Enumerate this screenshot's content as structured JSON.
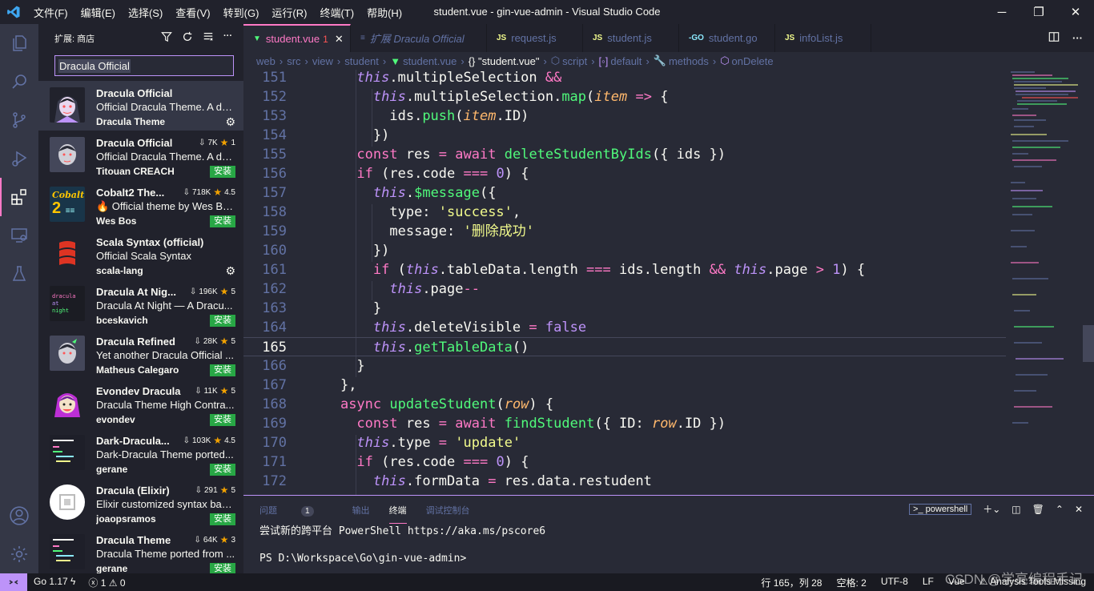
{
  "window": {
    "title": "student.vue - gin-vue-admin - Visual Studio Code",
    "menu": [
      "文件(F)",
      "编辑(E)",
      "选择(S)",
      "查看(V)",
      "转到(G)",
      "运行(R)",
      "终端(T)",
      "帮助(H)"
    ]
  },
  "sidebar": {
    "title": "扩展: 商店",
    "search_value": "Dracula Official",
    "install_label": "安装",
    "extensions": [
      {
        "name": "Dracula Official",
        "desc": "Official Dracula Theme. A da...",
        "publisher": "Dracula Theme",
        "downloads": "",
        "rating": "",
        "installed": true
      },
      {
        "name": "Dracula Official",
        "desc": "Official Dracula Theme. A da...",
        "publisher": "Titouan CREACH",
        "downloads": "7K",
        "rating": "1",
        "installed": false
      },
      {
        "name": "Cobalt2 The...",
        "desc": "🔥 Official theme by Wes Bos.",
        "publisher": "Wes Bos",
        "downloads": "718K",
        "rating": "4.5",
        "installed": false
      },
      {
        "name": "Scala Syntax (official)",
        "desc": "Official Scala Syntax",
        "publisher": "scala-lang",
        "downloads": "",
        "rating": "",
        "installed": true
      },
      {
        "name": "Dracula At Nig...",
        "desc": "Dracula At Night — A Dracu...",
        "publisher": "bceskavich",
        "downloads": "196K",
        "rating": "5",
        "installed": false
      },
      {
        "name": "Dracula Refined",
        "desc": "Yet another Dracula Official ...",
        "publisher": "Matheus Calegaro",
        "downloads": "28K",
        "rating": "5",
        "installed": false
      },
      {
        "name": "Evondev Dracula",
        "desc": "Dracula Theme High Contra...",
        "publisher": "evondev",
        "downloads": "11K",
        "rating": "5",
        "installed": false
      },
      {
        "name": "Dark-Dracula...",
        "desc": "Dark-Dracula Theme ported...",
        "publisher": "gerane",
        "downloads": "103K",
        "rating": "4.5",
        "installed": false
      },
      {
        "name": "Dracula (Elixir)",
        "desc": "Elixir customized syntax bas...",
        "publisher": "joaopsramos",
        "downloads": "291",
        "rating": "5",
        "installed": false
      },
      {
        "name": "Dracula Theme",
        "desc": "Dracula Theme ported from ...",
        "publisher": "gerane",
        "downloads": "64K",
        "rating": "3",
        "installed": false
      }
    ]
  },
  "tabs": [
    {
      "label": "student.vue",
      "badge": "1",
      "icon": "V",
      "active": true
    },
    {
      "label": "扩展 Dracula Official",
      "icon": "≡"
    },
    {
      "label": "request.js",
      "icon": "JS"
    },
    {
      "label": "student.js",
      "icon": "JS"
    },
    {
      "label": "student.go",
      "icon": "-GO"
    },
    {
      "label": "infoList.js",
      "icon": "JS"
    }
  ],
  "breadcrumb": [
    "web",
    "src",
    "view",
    "student",
    "student.vue",
    "{} \"student.vue\"",
    "script",
    "default",
    "methods",
    "onDelete"
  ],
  "editor": {
    "current_line": 165,
    "lines": [
      151,
      152,
      153,
      154,
      155,
      156,
      157,
      158,
      159,
      160,
      161,
      162,
      163,
      164,
      165,
      166,
      167,
      168,
      169,
      170,
      171,
      172
    ]
  },
  "panel": {
    "tabs": [
      "问题",
      "输出",
      "终端",
      "调试控制台"
    ],
    "problems_count": "1",
    "active_tab": "终端",
    "shell": "powershell",
    "terminal_lines": [
      "尝试新的跨平台 PowerShell https://aka.ms/pscore6",
      "",
      "PS D:\\Workspace\\Go\\gin-vue-admin>"
    ]
  },
  "statusbar": {
    "go_version": "Go 1.17",
    "errors": "1",
    "warnings": "0",
    "position": "行 165，列 28",
    "spaces": "空格: 2",
    "encoding": "UTF-8",
    "eol": "LF",
    "language": "Vue",
    "analysis": "Analysis Tools Missing"
  },
  "watermark": "CSDN @学亮编程手记",
  "colors": {
    "accent": "#ff79c6",
    "purple": "#bd93f9",
    "green": "#50fa7b",
    "background": "#282a36"
  }
}
